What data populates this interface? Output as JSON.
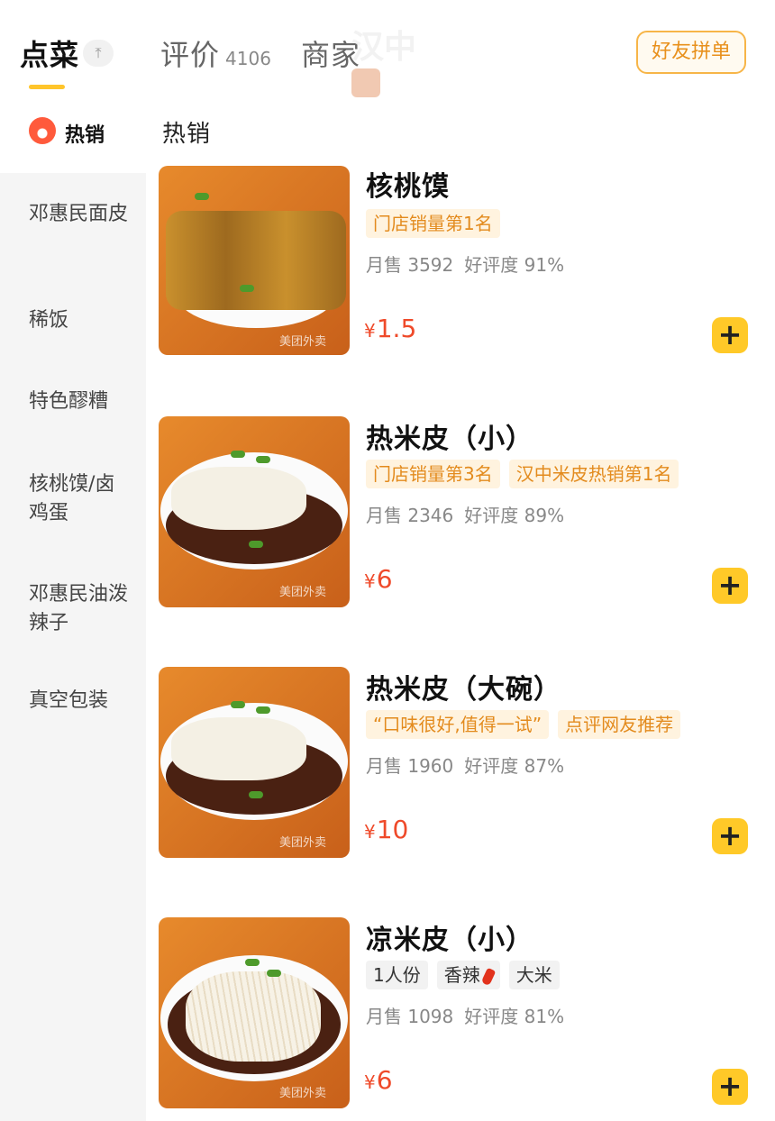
{
  "header": {
    "tabs": [
      {
        "label": "点菜",
        "active": true
      },
      {
        "label": "评价",
        "count": "4106"
      },
      {
        "label": "商家"
      }
    ],
    "collapse_icon": "arrow-up-icon",
    "collapse_glyph": "⤒",
    "friend_button": "好友拼单",
    "watermark_text": "汉中"
  },
  "sidebar": {
    "active_label": "热销",
    "items": [
      "邓惠民面皮",
      "稀饭",
      "特色醪糟",
      "核桃馍/卤鸡蛋",
      "邓惠民油泼辣子",
      "真空包装"
    ]
  },
  "section_title": "热销",
  "products": [
    {
      "name": "核桃馍",
      "tags": [
        "门店销量第1名"
      ],
      "monthly_sales": "月售 3592",
      "rating": "好评度 91%",
      "currency": "¥",
      "price": "1.5",
      "image_watermark": "美团外卖"
    },
    {
      "name": "热米皮（小）",
      "tags": [
        "门店销量第3名",
        "汉中米皮热销第1名"
      ],
      "monthly_sales": "月售 2346",
      "rating": "好评度 89%",
      "currency": "¥",
      "price": "6",
      "image_watermark": "美团外卖"
    },
    {
      "name": "热米皮（大碗）",
      "tags": [
        "“口味很好,值得一试”",
        "点评网友推荐"
      ],
      "monthly_sales": "月售 1960",
      "rating": "好评度 87%",
      "currency": "¥",
      "price": "10",
      "image_watermark": "美团外卖"
    },
    {
      "name": "凉米皮（小）",
      "tags": [
        "1人份",
        "香辣",
        "大米"
      ],
      "monthly_sales": "月售 1098",
      "rating": "好评度 81%",
      "currency": "¥",
      "price": "6",
      "image_watermark": "美团外卖"
    }
  ],
  "add_button_glyph": "+",
  "colors": {
    "accent": "#ffc928",
    "price": "#ef4a2a",
    "tag_orange": "#e38b1e"
  }
}
